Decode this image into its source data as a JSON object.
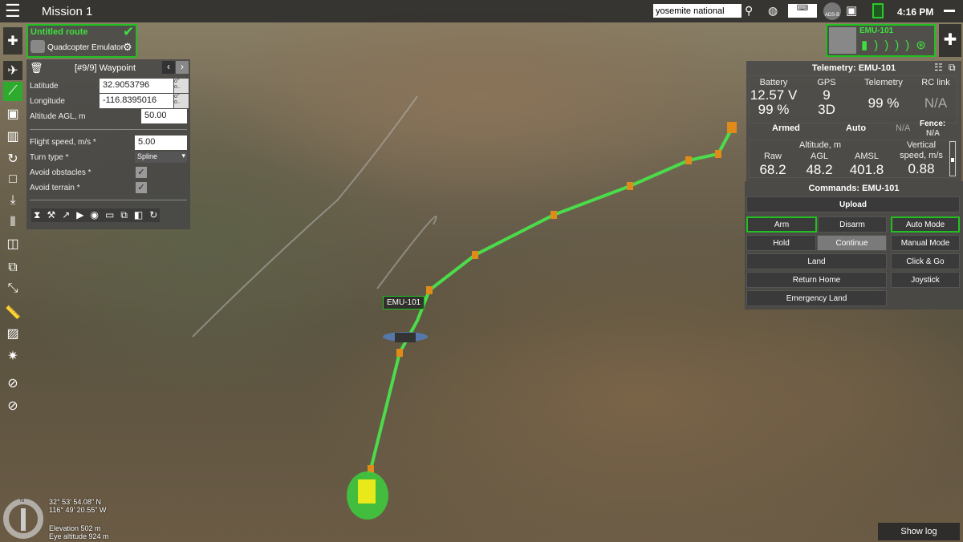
{
  "topbar": {
    "title": "Mission 1",
    "search_value": "yosemite national",
    "adsb_label": "ADS-B",
    "time": "4:16 PM"
  },
  "route": {
    "name": "Untitled route",
    "vehicle": "Quadcopter Emulator"
  },
  "waypoint": {
    "title": "[#9/9] Waypoint",
    "latitude_label": "Latitude",
    "latitude": "32.9053796",
    "longitude_label": "Longitude",
    "longitude": "-116.8395016",
    "altitude_label": "Altitude AGL, m",
    "altitude": "50.00",
    "speed_label": "Flight speed, m/s *",
    "speed": "5.00",
    "turn_label": "Turn type *",
    "turn": "Spline",
    "obstacles_label": "Avoid obstacles *",
    "obstacles_checked": true,
    "terrain_label": "Avoid terrain *",
    "terrain_checked": true
  },
  "drone": {
    "name": "EMU-101",
    "map_label": "EMU-101"
  },
  "telemetry": {
    "title": "Telemetry: EMU-101",
    "battery_label": "Battery",
    "battery_v": "12.57 V",
    "battery_pct": "99 %",
    "gps_label": "GPS",
    "gps_sats": "9",
    "gps_fix": "3D",
    "telemetry_label": "Telemetry",
    "telemetry_pct": "99 %",
    "rc_label": "RC link",
    "rc_value": "N/A",
    "armed": "Armed",
    "mode": "Auto",
    "na": "N/A",
    "fence_label": "Fence:",
    "fence_value": "N/A",
    "altitude_label": "Altitude, m",
    "raw_label": "Raw",
    "raw": "68.2",
    "agl_label": "AGL",
    "agl": "48.2",
    "amsl_label": "AMSL",
    "amsl": "401.8",
    "vs_label": "Vertical speed, m/s",
    "vs": "0.88"
  },
  "commands": {
    "title": "Commands: EMU-101",
    "upload": "Upload",
    "arm": "Arm",
    "disarm": "Disarm",
    "auto_mode": "Auto Mode",
    "hold": "Hold",
    "continue": "Continue",
    "manual_mode": "Manual Mode",
    "land": "Land",
    "click_go": "Click & Go",
    "return_home": "Return Home",
    "joystick": "Joystick",
    "emergency_land": "Emergency Land"
  },
  "map": {
    "lat": "32° 53' 54.08\" N",
    "lon": "116° 49' 20.55\" W",
    "elevation": "Elevation 502 m",
    "eye_altitude": "Eye altitude 924 m",
    "compass_n": "N"
  },
  "show_log": "Show log",
  "colors": {
    "accent": "#21c021",
    "panel": "#464646"
  }
}
